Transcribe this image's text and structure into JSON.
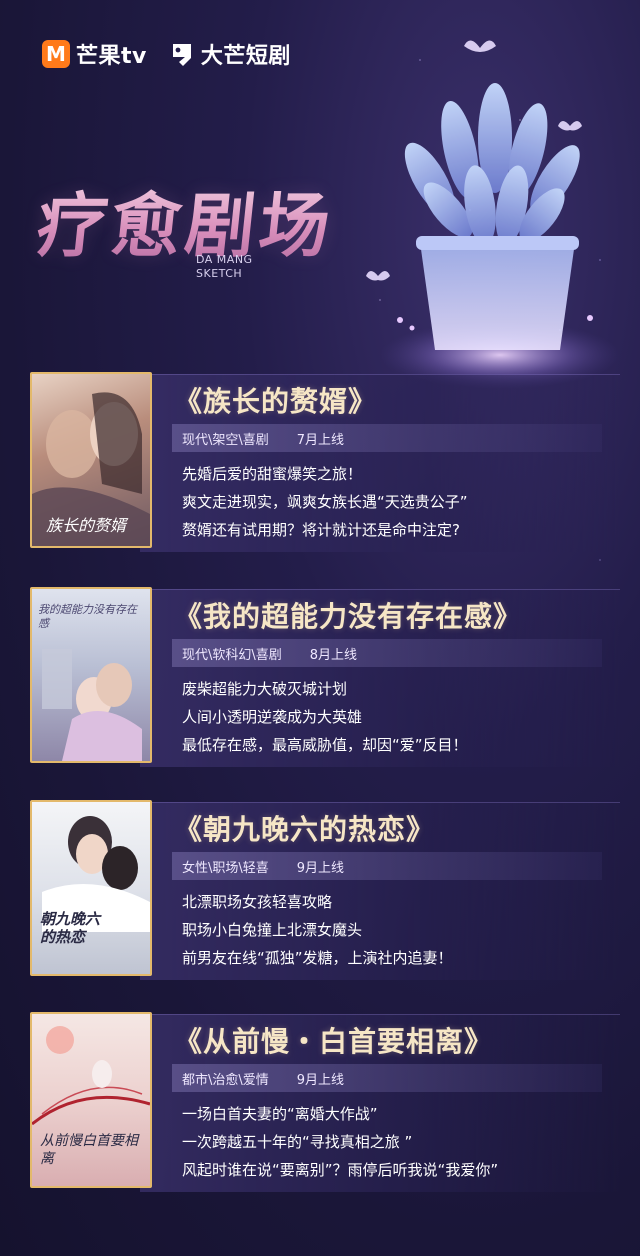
{
  "logos": {
    "mango": "芒果tv",
    "damang": "大芒短剧"
  },
  "hero": {
    "title": "疗愈剧场",
    "subtitle_line1": "DA MANG",
    "subtitle_line2": "SKETCH"
  },
  "dramas": [
    {
      "title": "《族长的赘婿》",
      "tags": "现代\\架空\\喜剧",
      "release": "7月上线",
      "poster_text": "族长的赘婿",
      "lines": [
        "先婚后爱的甜蜜爆笑之旅！",
        "爽文走进现实，飒爽女族长遇“天选贵公子”",
        "赘婿还有试用期？将计就计还是命中注定?"
      ]
    },
    {
      "title": "《我的超能力没有存在感》",
      "tags": "现代\\软科幻\\喜剧",
      "release": "8月上线",
      "poster_text": "我的超能力没有存在感",
      "lines": [
        "废柴超能力大破灭城计划",
        "人间小透明逆袭成为大英雄",
        "最低存在感，最高威胁值，却因“爱”反目！"
      ]
    },
    {
      "title": "《朝九晚六的热恋》",
      "tags": "女性\\职场\\轻喜",
      "release": "9月上线",
      "poster_text": "朝九晚六的热恋",
      "lines": [
        "北漂职场女孩轻喜攻略",
        "职场小白兔撞上北漂女魔头",
        "前男友在线“孤独”发糖，上演社内追妻！"
      ]
    },
    {
      "title": "《从前慢・白首要相离》",
      "tags": "都市\\治愈\\爱情",
      "release": "9月上线",
      "poster_text": "从前慢白首要相离",
      "lines": [
        "一场白首夫妻的“离婚大作战”",
        "一次跨越五十年的“寻找真相之旅 ”",
        "风起时谁在说“要离别”？雨停后听我说“我爱你”"
      ]
    }
  ],
  "colors": {
    "accent_gold": "#e3b96b",
    "title_pink": "#d58db8",
    "mango_orange": "#ff7a1a"
  },
  "icons": [
    "mango-logo-icon",
    "damang-logo-icon",
    "butterfly-icon",
    "succulent-plant-illustration"
  ]
}
